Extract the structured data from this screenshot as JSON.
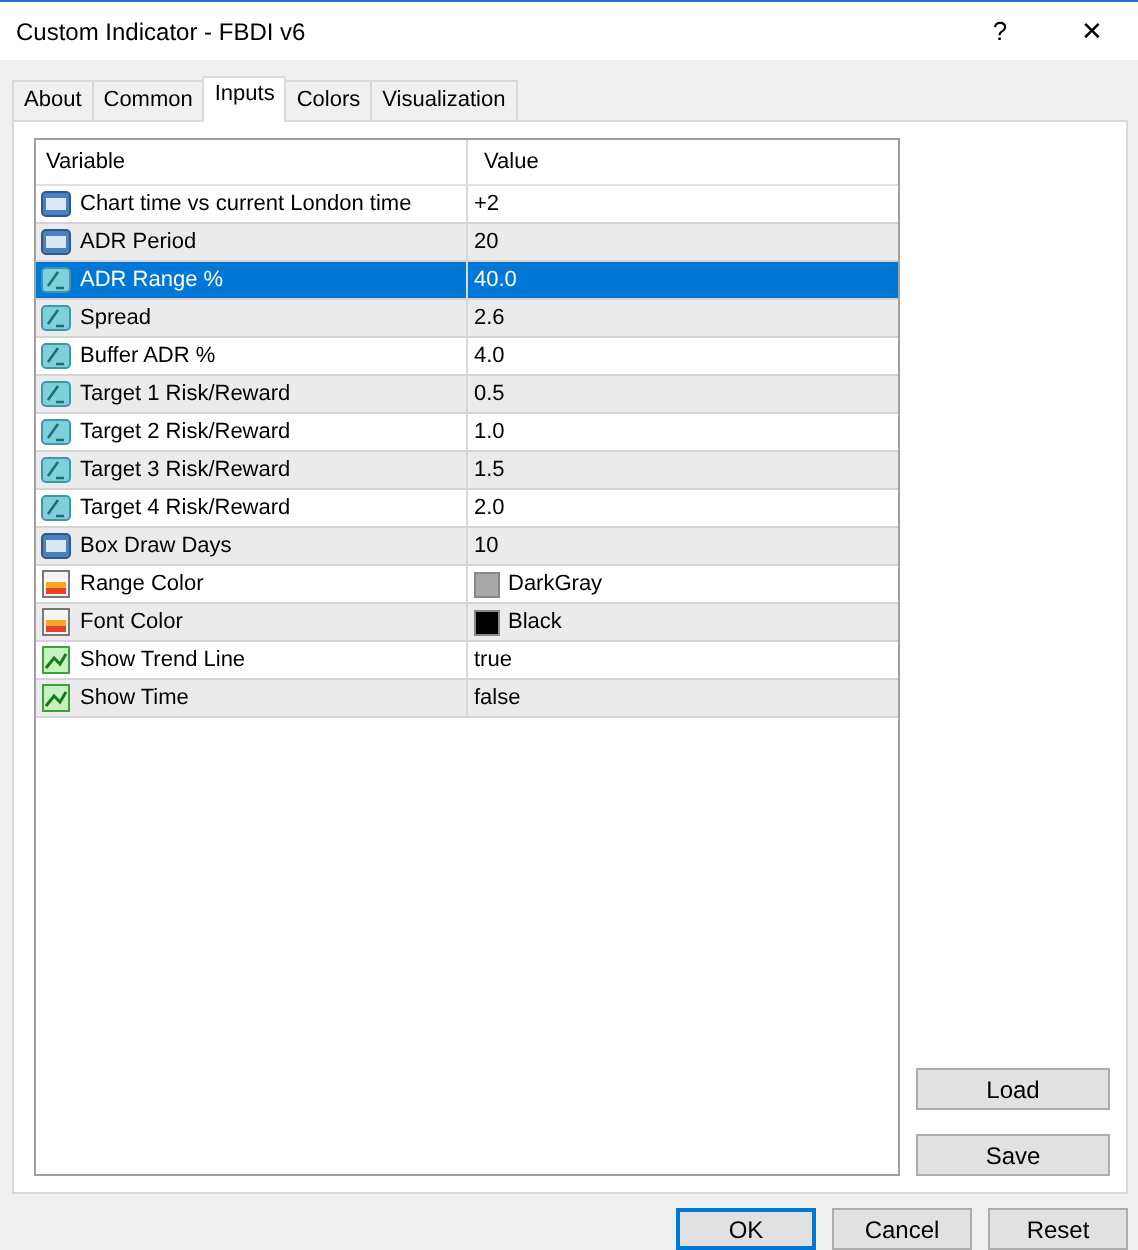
{
  "window": {
    "title": "Custom Indicator - FBDI v6",
    "help": "?",
    "close": "✕"
  },
  "tabs": [
    {
      "label": "About",
      "selected": false
    },
    {
      "label": "Common",
      "selected": false
    },
    {
      "label": "Inputs",
      "selected": true
    },
    {
      "label": "Colors",
      "selected": false
    },
    {
      "label": "Visualization",
      "selected": false
    }
  ],
  "table": {
    "columns": [
      "Variable",
      "Value"
    ],
    "rows": [
      {
        "kind": "int",
        "variable": "Chart time vs current London time",
        "value": "+2",
        "selected": false
      },
      {
        "kind": "int",
        "variable": "ADR Period",
        "value": "20",
        "selected": false
      },
      {
        "kind": "double",
        "variable": "ADR Range %",
        "value": "40.0",
        "selected": true
      },
      {
        "kind": "double",
        "variable": "Spread",
        "value": "2.6",
        "selected": false
      },
      {
        "kind": "double",
        "variable": "Buffer ADR %",
        "value": "4.0",
        "selected": false
      },
      {
        "kind": "double",
        "variable": "Target 1 Risk/Reward",
        "value": "0.5",
        "selected": false
      },
      {
        "kind": "double",
        "variable": "Target 2 Risk/Reward",
        "value": "1.0",
        "selected": false
      },
      {
        "kind": "double",
        "variable": "Target 3 Risk/Reward",
        "value": "1.5",
        "selected": false
      },
      {
        "kind": "double",
        "variable": "Target 4 Risk/Reward",
        "value": "2.0",
        "selected": false
      },
      {
        "kind": "int",
        "variable": "Box Draw Days",
        "value": "10",
        "selected": false
      },
      {
        "kind": "color",
        "variable": "Range Color",
        "value": "DarkGray",
        "color": "#a9a9a9",
        "selected": false
      },
      {
        "kind": "color",
        "variable": "Font Color",
        "value": "Black",
        "color": "#000000",
        "selected": false
      },
      {
        "kind": "bool",
        "variable": "Show Trend Line",
        "value": "true",
        "selected": false
      },
      {
        "kind": "bool",
        "variable": "Show Time",
        "value": "false",
        "selected": false
      }
    ]
  },
  "side_buttons": [
    "Load",
    "Save"
  ],
  "buttons": [
    {
      "label": "OK",
      "default": true
    },
    {
      "label": "Cancel",
      "default": false
    },
    {
      "label": "Reset",
      "default": false
    }
  ]
}
